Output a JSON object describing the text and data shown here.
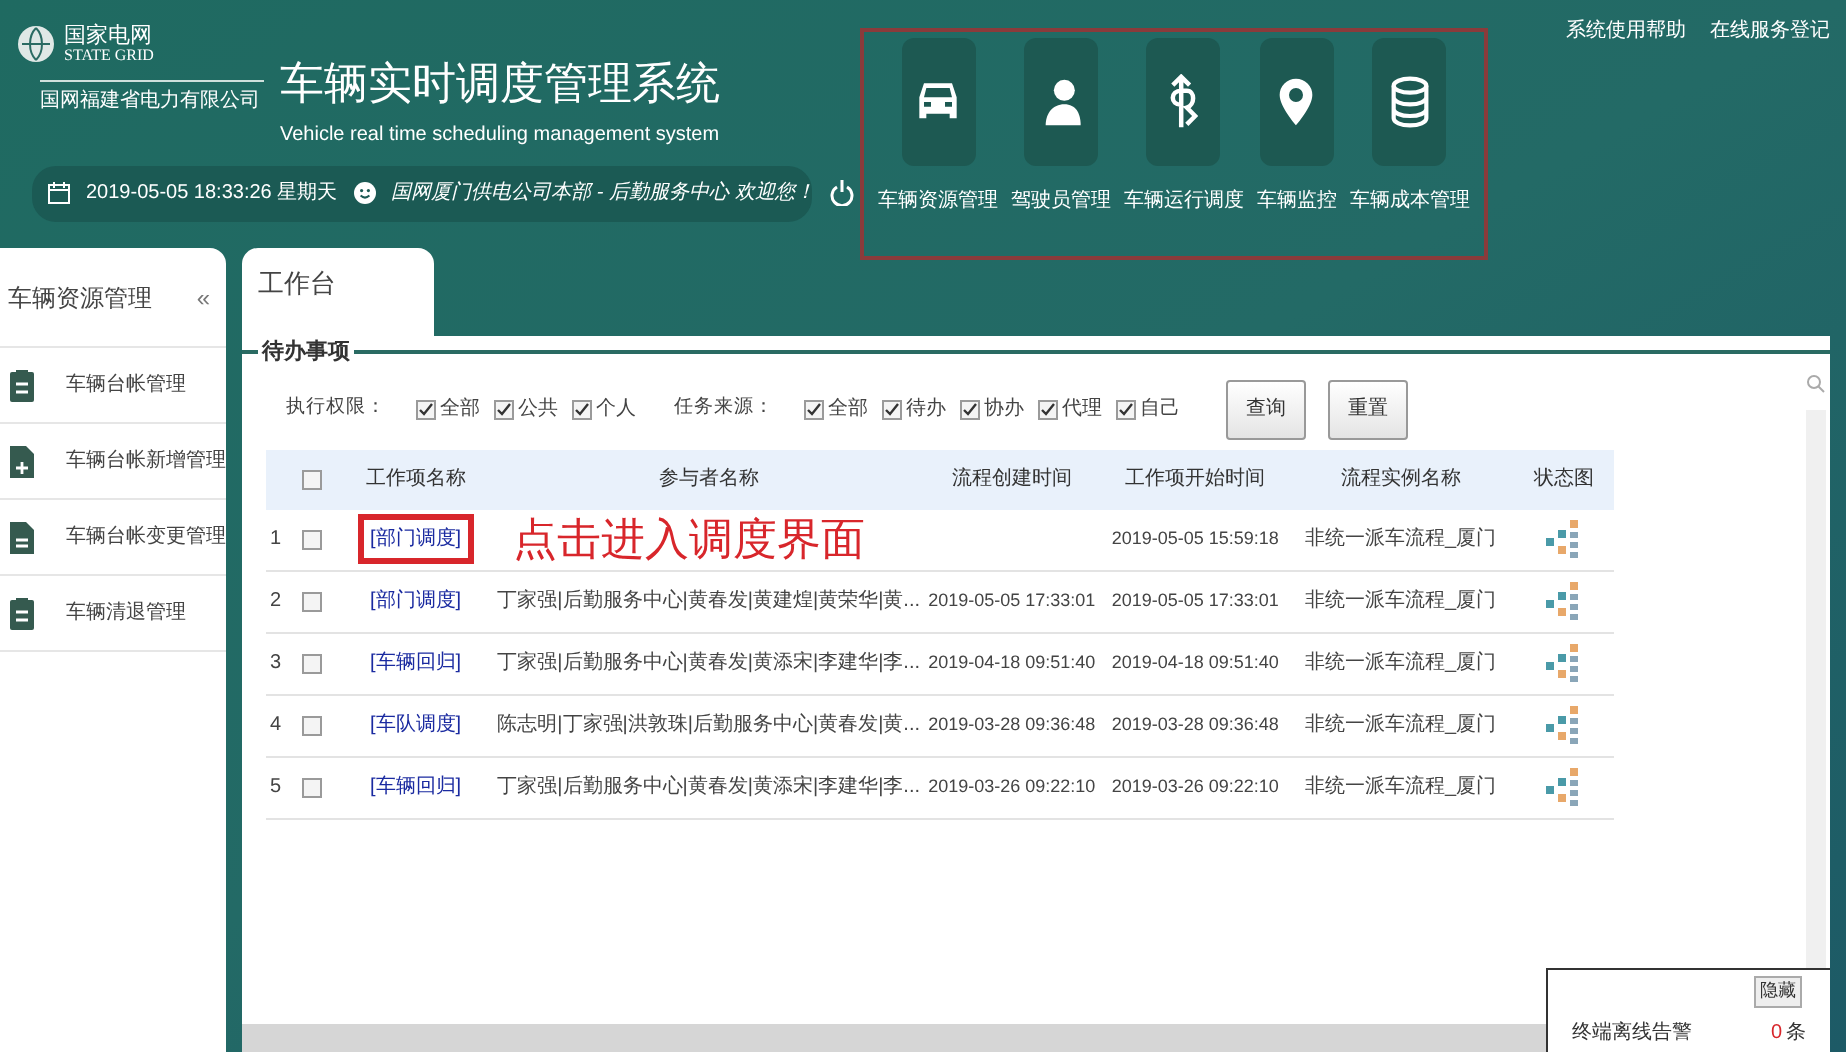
{
  "header": {
    "logo_title": "国家电网",
    "logo_subtitle": "STATE GRID",
    "logo_company": "国网福建省电力有限公司",
    "title": "车辆实时调度管理系统",
    "subtitle": "Vehicle real time scheduling management system",
    "datetime": "2019-05-05 18:33:26 星期天",
    "welcome": "国网厦门供电公司本部 - 后勤服务中心 欢迎您！",
    "links": [
      "系统使用帮助",
      "在线服务登记"
    ]
  },
  "modules": [
    {
      "kind": "car",
      "label": "车辆资源管理"
    },
    {
      "kind": "person",
      "label": "驾驶员管理"
    },
    {
      "kind": "route",
      "label": "车辆运行调度"
    },
    {
      "kind": "pin",
      "label": "车辆监控"
    },
    {
      "kind": "database",
      "label": "车辆成本管理"
    }
  ],
  "sidebar": {
    "title": "车辆资源管理",
    "collapse": "«",
    "items": [
      {
        "kind": "clipboard",
        "label": "车辆台帐管理"
      },
      {
        "kind": "add",
        "label": "车辆台帐新增管理"
      },
      {
        "kind": "edit",
        "label": "车辆台帐变更管理"
      },
      {
        "kind": "clipboard",
        "label": "车辆清退管理"
      }
    ]
  },
  "tabs": [
    {
      "label": "工作台",
      "selected": true
    }
  ],
  "section_title": "待办事项",
  "filters": [
    {
      "label": "执行权限：",
      "options": [
        {
          "label": "全部",
          "checked": true
        },
        {
          "label": "公共",
          "checked": true
        },
        {
          "label": "个人",
          "checked": true
        }
      ]
    },
    {
      "label": "任务来源：",
      "options": [
        {
          "label": "全部",
          "checked": true
        },
        {
          "label": "待办",
          "checked": true
        },
        {
          "label": "协办",
          "checked": true
        },
        {
          "label": "代理",
          "checked": true
        },
        {
          "label": "自己",
          "checked": true
        }
      ]
    }
  ],
  "buttons": [
    "查询",
    "重置"
  ],
  "table": {
    "select_all": {
      "checked": false
    },
    "columns": [
      "工作项名称",
      "参与者名称",
      "流程创建时间",
      "工作项开始时间",
      "流程实例名称",
      "状态图"
    ],
    "rows": [
      {
        "index": "1",
        "checked": false,
        "name": "[部门调度]",
        "highlighted": true,
        "annotation": "点击进入调度界面",
        "start": "2019-05-05 15:59:18",
        "process": "非统一派车流程_厦门"
      },
      {
        "index": "2",
        "checked": false,
        "name": "[部门调度]",
        "participants": "丁家强|后勤服务中心|黄春发|黄建煌|黄荣华|黄...",
        "created": "2019-05-05 17:33:01",
        "start": "2019-05-05 17:33:01",
        "process": "非统一派车流程_厦门"
      },
      {
        "index": "3",
        "checked": false,
        "name": "[车辆回归]",
        "participants": "丁家强|后勤服务中心|黄春发|黄添宋|李建华|李...",
        "created": "2019-04-18 09:51:40",
        "start": "2019-04-18 09:51:40",
        "process": "非统一派车流程_厦门"
      },
      {
        "index": "4",
        "checked": false,
        "name": "[车队调度]",
        "participants": "陈志明|丁家强|洪敦珠|后勤服务中心|黄春发|黄...",
        "created": "2019-03-28 09:36:48",
        "start": "2019-03-28 09:36:48",
        "process": "非统一派车流程_厦门"
      },
      {
        "index": "5",
        "checked": false,
        "name": "[车辆回归]",
        "participants": "丁家强|后勤服务中心|黄春发|黄添宋|李建华|李...",
        "created": "2019-03-26 09:22:10",
        "start": "2019-03-26 09:22:10",
        "process": "非统一派车流程_厦门"
      }
    ]
  },
  "alert_popup": {
    "hide_button": "隐藏",
    "label": "终端离线告警",
    "count": "0",
    "unit": "条"
  }
}
